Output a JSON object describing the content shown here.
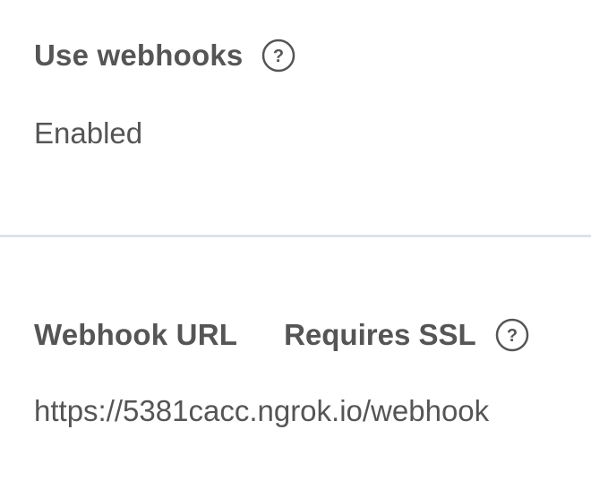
{
  "webhooks": {
    "label": "Use webhooks",
    "value": "Enabled",
    "help_icon": "question-circle-icon"
  },
  "webhook_url": {
    "label": "Webhook URL",
    "note": "Requires SSL",
    "value": "https://5381cacc.ngrok.io/webhook",
    "help_icon": "question-circle-icon"
  },
  "colors": {
    "text": "#555555",
    "divider": "#dde3ea",
    "background": "#ffffff"
  }
}
